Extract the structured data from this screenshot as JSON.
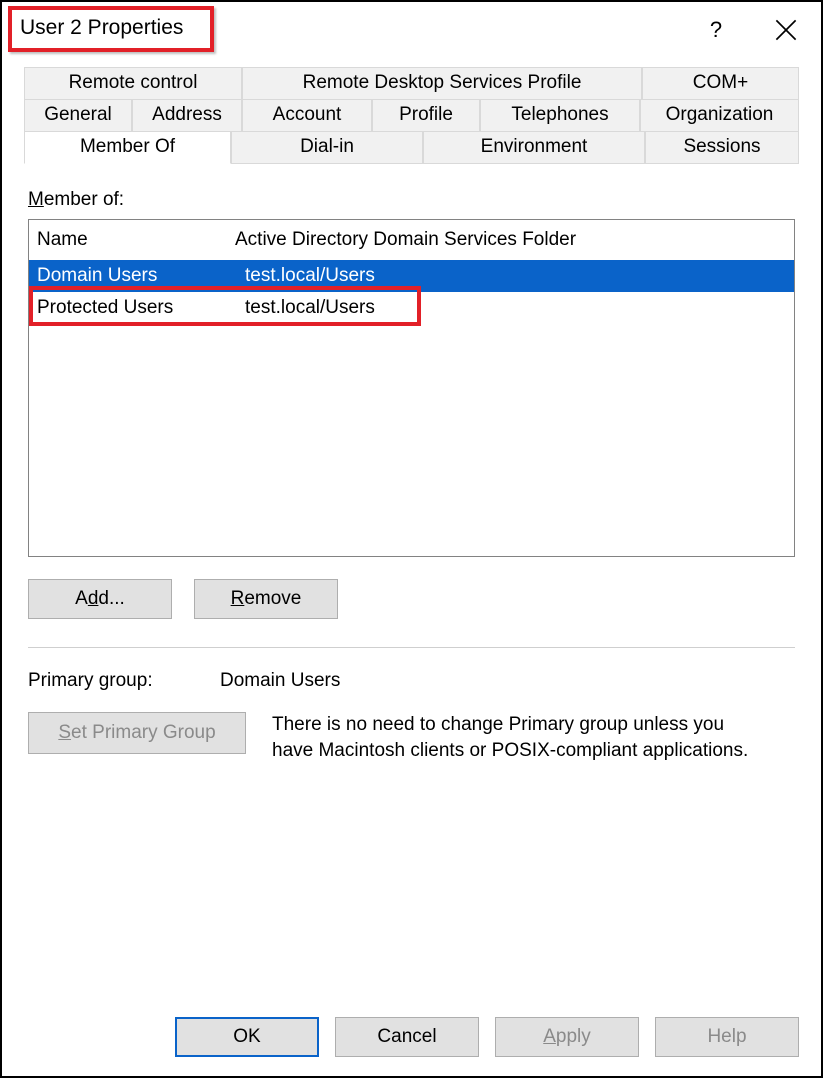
{
  "window": {
    "title": "User 2 Properties"
  },
  "tabs": {
    "row1": [
      {
        "label": "Remote control"
      },
      {
        "label": "Remote Desktop Services Profile"
      },
      {
        "label": "COM+"
      }
    ],
    "row2": [
      {
        "label": "General"
      },
      {
        "label": "Address"
      },
      {
        "label": "Account"
      },
      {
        "label": "Profile"
      },
      {
        "label": "Telephones"
      },
      {
        "label": "Organization"
      }
    ],
    "row3": [
      {
        "label": "Member Of",
        "active": true
      },
      {
        "label": "Dial-in"
      },
      {
        "label": "Environment"
      },
      {
        "label": "Sessions"
      }
    ]
  },
  "memberof": {
    "section_label_pre": "M",
    "section_label_post": "ember of:",
    "columns": {
      "name": "Name",
      "folder": "Active Directory Domain Services Folder"
    },
    "rows": [
      {
        "name": "Domain Users",
        "folder": "test.local/Users",
        "selected": true
      },
      {
        "name": "Protected Users",
        "folder": "test.local/Users"
      }
    ],
    "buttons": {
      "add_pre": "A",
      "add_ul": "d",
      "add_post": "d...",
      "remove_ul": "R",
      "remove_post": "emove"
    }
  },
  "primary": {
    "label": "Primary group:",
    "value": "Domain Users",
    "button_pre": "",
    "button_ul": "S",
    "button_post": "et Primary Group",
    "note": "There is no need to change Primary group unless you have Macintosh clients or POSIX-compliant applications."
  },
  "footer": {
    "ok": "OK",
    "cancel": "Cancel",
    "apply_ul": "A",
    "apply_post": "pply",
    "help": "Help"
  }
}
